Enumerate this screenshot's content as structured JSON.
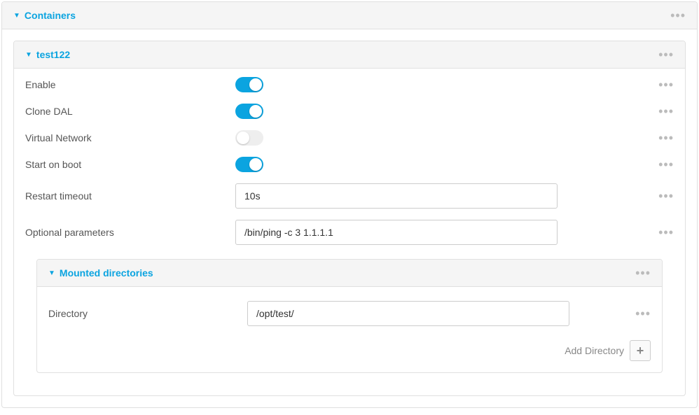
{
  "containers": {
    "title": "Containers"
  },
  "container_item": {
    "name": "test122",
    "fields": {
      "enable": {
        "label": "Enable",
        "state": "on"
      },
      "clone_dal": {
        "label": "Clone DAL",
        "state": "on"
      },
      "virtual_network": {
        "label": "Virtual Network",
        "state": "off"
      },
      "start_on_boot": {
        "label": "Start on boot",
        "state": "on"
      },
      "restart_timeout": {
        "label": "Restart timeout",
        "value": "10s"
      },
      "optional_params": {
        "label": "Optional parameters",
        "value": "/bin/ping -c 3 1.1.1.1"
      }
    },
    "mounted_directories": {
      "title": "Mounted directories",
      "directory": {
        "label": "Directory",
        "value": "/opt/test/"
      },
      "add_label": "Add Directory"
    }
  }
}
